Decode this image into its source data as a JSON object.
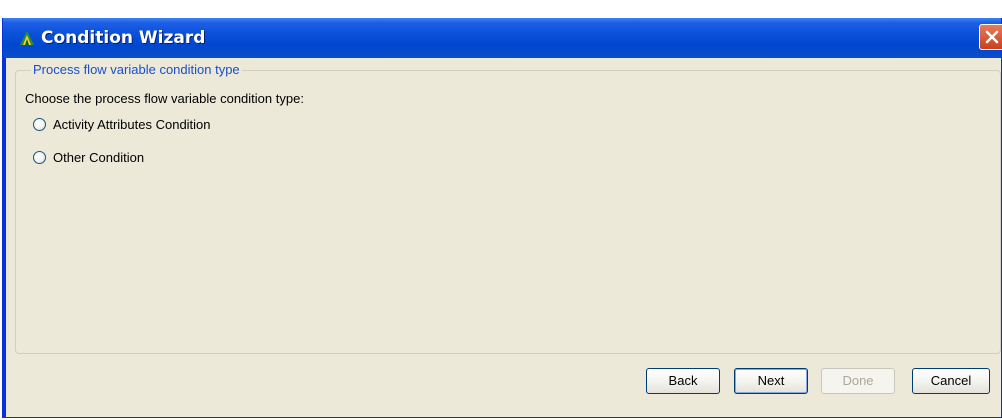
{
  "window": {
    "title": "Condition Wizard",
    "app_icon": "condition-wizard-app-icon",
    "close_icon": "close-x-icon"
  },
  "group": {
    "legend": "Process flow variable condition type",
    "prompt": "Choose the process flow variable condition type:",
    "options": [
      {
        "label": "Activity Attributes Condition",
        "selected": false
      },
      {
        "label": "Other Condition",
        "selected": false
      }
    ]
  },
  "buttons": {
    "back": "Back",
    "next": "Next",
    "done": "Done",
    "cancel": "Cancel"
  },
  "colors": {
    "titlebar": "#0a51d8",
    "dialog_bg": "#ece9d8",
    "legend_text": "#1a4fc7",
    "close_button": "#e0583a"
  }
}
